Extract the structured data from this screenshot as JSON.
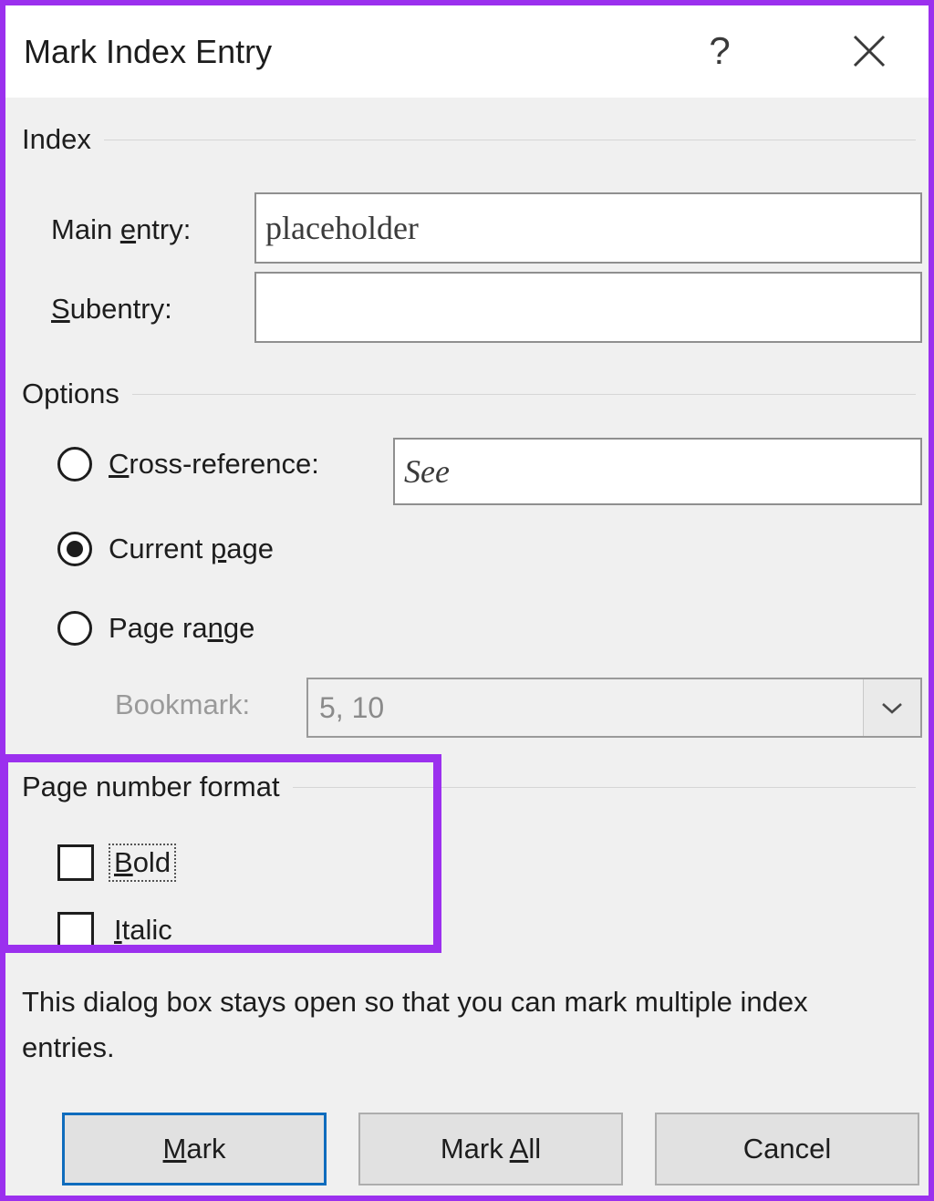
{
  "dialog": {
    "title": "Mark Index Entry",
    "accent_purple": "#9B30EE",
    "default_button_border": "#0f6cbd",
    "background": "#f0f0f0",
    "help_glyph": "?",
    "help_name": "help-icon",
    "close_name": "close-icon"
  },
  "index_group": {
    "heading": "Index",
    "main_entry": {
      "label_pre": "Main ",
      "label_accel": "e",
      "label_post": "ntry:",
      "value": "placeholder",
      "placeholder": ""
    },
    "subentry": {
      "label_pre": "",
      "label_accel": "S",
      "label_post": "ubentry:",
      "value": "",
      "placeholder": ""
    }
  },
  "options_group": {
    "heading": "Options",
    "cross_reference": {
      "label_pre": "",
      "label_accel": "C",
      "label_post": "ross-reference:",
      "selected": false,
      "value": "See",
      "placeholder": ""
    },
    "current_page": {
      "label_pre": "Current ",
      "label_accel": "p",
      "label_post": "age",
      "selected": true
    },
    "page_range": {
      "label_pre": "Page ra",
      "label_accel": "n",
      "label_post": "ge",
      "selected": false
    },
    "bookmark": {
      "label": "Bookmark:",
      "value": "5, 10",
      "disabled": true,
      "arrow_icon": "chevron-down-icon"
    }
  },
  "page_number_format_group": {
    "heading": "Page number format",
    "bold": {
      "label_pre": "",
      "label_accel": "B",
      "label_post": "old",
      "checked": false,
      "focused": true
    },
    "italic": {
      "label_pre": "",
      "label_accel": "I",
      "label_post": "talic",
      "checked": false,
      "focused": false
    }
  },
  "info_text": "This dialog box stays open so that you can mark multiple index entries.",
  "buttons": {
    "mark": {
      "label_pre": "",
      "label_accel": "M",
      "label_post": "ark",
      "is_default": true
    },
    "mark_all": {
      "label_pre": "Mark ",
      "label_accel": "A",
      "label_post": "ll",
      "is_default": false
    },
    "cancel": {
      "label_pre": "Cancel",
      "label_accel": "",
      "label_post": "",
      "is_default": false
    }
  }
}
